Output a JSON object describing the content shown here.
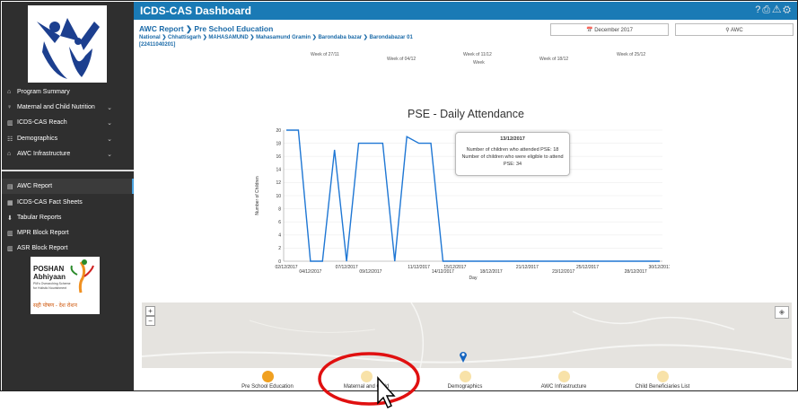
{
  "header": {
    "title": "ICDS-CAS Dashboard"
  },
  "sidebar": {
    "items": [
      {
        "icon": "home-icon",
        "glyph": "⌂",
        "label": "Program Summary",
        "chev": false
      },
      {
        "icon": "person-icon",
        "glyph": "♀",
        "label": "Maternal and Child Nutrition",
        "chev": true
      },
      {
        "icon": "bar-chart-icon",
        "glyph": "▥",
        "label": "ICDS-CAS Reach",
        "chev": true
      },
      {
        "icon": "group-icon",
        "glyph": "☷",
        "label": "Demographics",
        "chev": true
      },
      {
        "icon": "building-icon",
        "glyph": "⌂",
        "label": "AWC Infrastructure",
        "chev": true
      },
      {
        "icon": "report-icon",
        "glyph": "▤",
        "label": "AWC Report",
        "chev": false
      },
      {
        "icon": "sheet-icon",
        "glyph": "▦",
        "label": "ICDS-CAS Fact Sheets",
        "chev": false
      },
      {
        "icon": "download-icon",
        "glyph": "⬇",
        "label": "Tabular Reports",
        "chev": false
      },
      {
        "icon": "chart-icon",
        "glyph": "▥",
        "label": "MPR Block Report",
        "chev": false
      },
      {
        "icon": "chart-icon",
        "glyph": "▥",
        "label": "ASR Block Report",
        "chev": false
      }
    ],
    "poshan": {
      "name": "POSHAN",
      "name2": "Abhiyaan",
      "tagline": "PM's Overarching Scheme for Holistic Nourishment",
      "hindi": "सही पोषण - देश रोशन"
    }
  },
  "report": {
    "title": "AWC Report ❯ Pre School Education",
    "breadcrumb": "National ❯ Chhattisgarh ❯ MAHASAMUND ❯ Mahasamund Gramin ❯ Barondaba bazar ❯ Barondabazar 01 [22411040201]"
  },
  "filters": {
    "month": "📅 December 2017",
    "level": "⚲ AWC"
  },
  "weeks": {
    "items": [
      "Week of 27/11",
      "Week of 04/12",
      "Week of 11/12",
      "Week of 18/12",
      "Week of 25/12"
    ],
    "axis_label": "Week"
  },
  "chart_data": {
    "type": "line",
    "title": "PSE - Daily Attendance",
    "xlabel": "Day",
    "ylabel": "Number of Children",
    "ylim": [
      0,
      20
    ],
    "yticks": [
      0,
      2,
      4,
      6,
      8,
      10,
      12,
      14,
      16,
      18,
      20
    ],
    "xtick_labels": [
      "02/12/2017",
      "04/12/2017",
      "07/12/2017",
      "09/12/2017",
      "11/12/2017",
      "14/12/2017",
      "15/12/2017",
      "18/12/2017",
      "21/12/2017",
      "23/12/2017",
      "25/12/2017",
      "28/12/2017",
      "30/12/2017"
    ],
    "series": [
      {
        "color": "#1f77d4",
        "values": [
          20,
          20,
          0,
          0,
          17,
          0,
          18,
          18,
          18,
          0,
          19,
          18,
          18,
          0,
          0,
          0,
          0,
          0,
          0,
          0,
          0,
          0,
          0,
          0,
          0,
          0,
          0,
          0,
          0,
          0,
          0,
          0
        ]
      }
    ]
  },
  "tooltip": {
    "date": "13/12/2017",
    "line1": "Number of children who attended PSE: 18",
    "line2": "Number of children who were eligible to attend",
    "line3": "PSE: 34"
  },
  "legend": {
    "items": [
      {
        "label": "Pre School Education",
        "active": true
      },
      {
        "label": "Maternal and Child",
        "active": false
      },
      {
        "label": "Demographics",
        "active": false
      },
      {
        "label": "AWC Infrastructure",
        "active": false
      },
      {
        "label": "Child Beneficiaries List",
        "active": false
      }
    ]
  },
  "colors": {
    "header": "#1a7ab5",
    "sidebar": "#2f2f2f",
    "line": "#1f77d4",
    "legend_active": "#f0a020",
    "annotation": "#e01010"
  }
}
